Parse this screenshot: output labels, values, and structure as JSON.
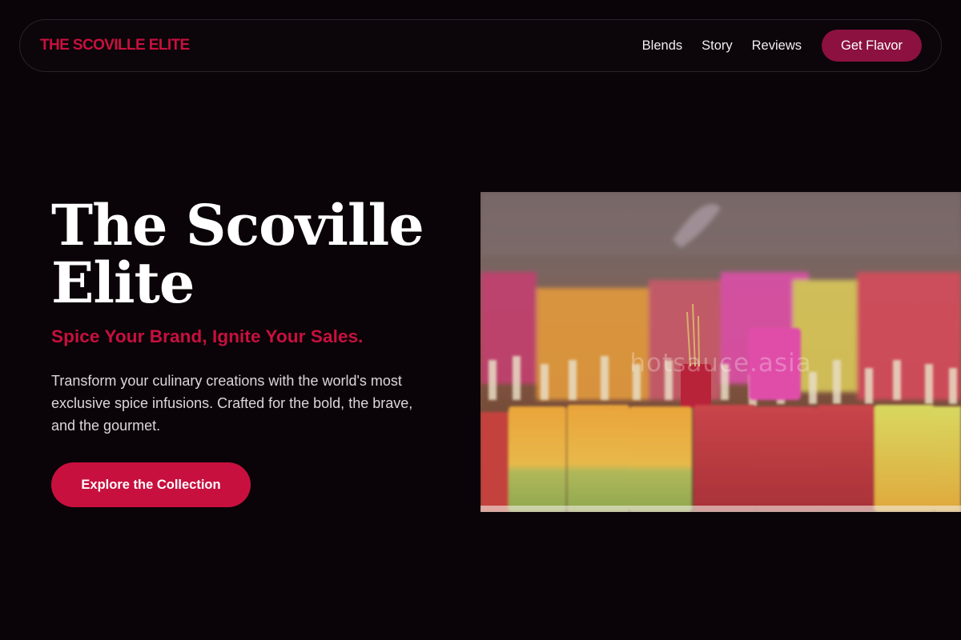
{
  "header": {
    "logo": "THE SCOVILLE ELITE",
    "nav_links": [
      "Blends",
      "Story",
      "Reviews"
    ],
    "cta_label": "Get Flavor"
  },
  "hero": {
    "title_line1": "The Scoville",
    "title_line2": "Elite",
    "tagline": "Spice Your Brand, Ignite Your Sales.",
    "description": "Transform your culinary creations with the world's most exclusive spice infusions. Crafted for the bold, the brave, and the gourmet.",
    "button_label": "Explore the Collection"
  },
  "image": {
    "watermark": "hotsauce.asia",
    "subject": "colorful-popsicles-photo"
  },
  "colors": {
    "background": "#0a0307",
    "accent": "#c8103f",
    "cta": "#8c1140"
  }
}
